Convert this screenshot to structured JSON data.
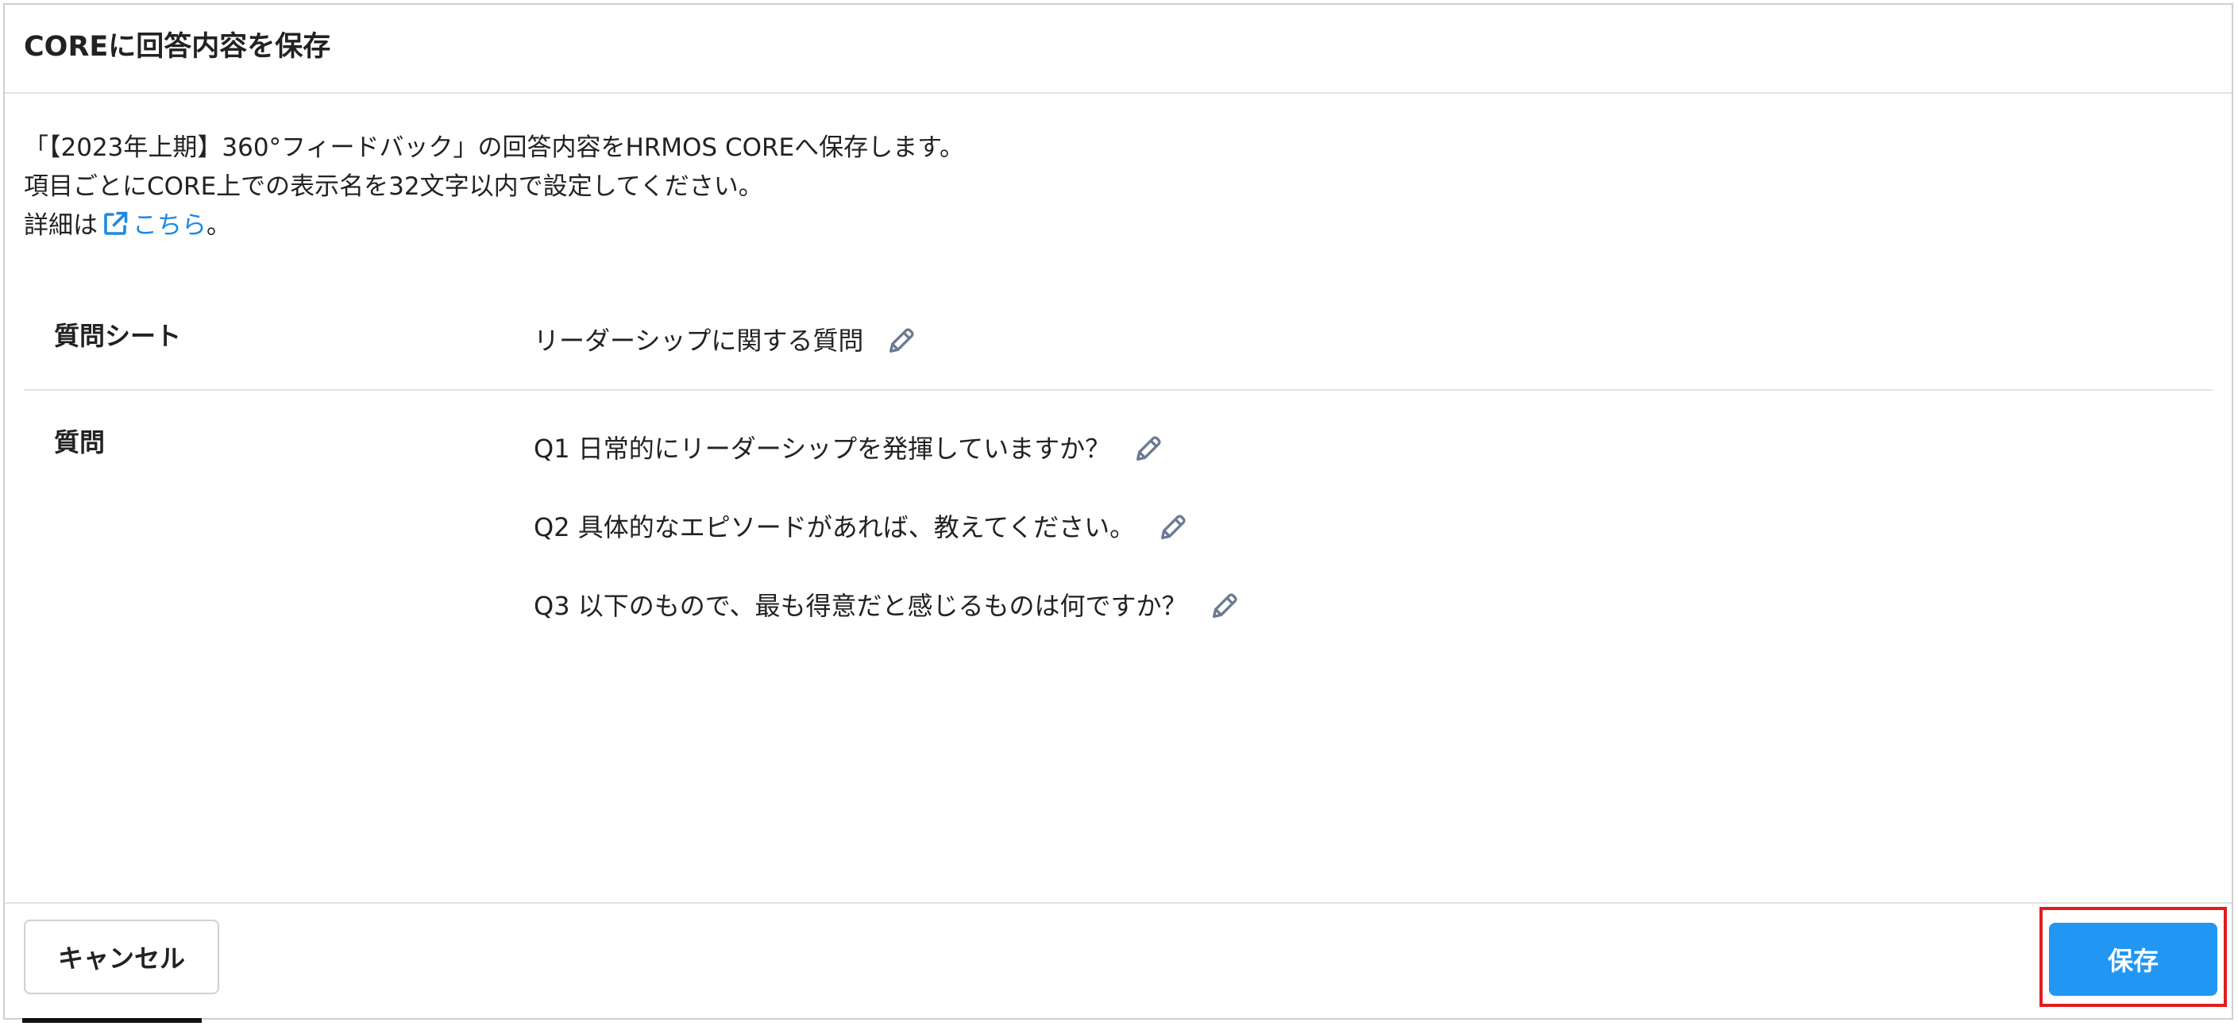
{
  "dialog": {
    "title": "COREに回答内容を保存"
  },
  "intro": {
    "line1": "「【2023年上期】360°フィードバック」の回答内容をHRMOS COREへ保存します。",
    "line2": "項目ごとにCORE上での表示名を32文字以内で設定してください。",
    "line3_prefix": "詳細は",
    "link_label": "こちら",
    "line3_suffix": "。"
  },
  "question_sheet": {
    "label": "質問シート",
    "value": "リーダーシップに関する質問"
  },
  "questions": {
    "label": "質問",
    "items": [
      {
        "text": "Q1 日常的にリーダーシップを発揮していますか？"
      },
      {
        "text": "Q2 具体的なエピソードがあれば、教えてください。"
      },
      {
        "text": "Q3 以下のもので、最も得意だと感じるものは何ですか？"
      }
    ]
  },
  "footer": {
    "cancel_label": "キャンセル",
    "save_label": "保存"
  },
  "colors": {
    "accent": "#2196f3",
    "link": "#1e88e5",
    "highlight": "#e01e1e",
    "icon": "#6b7a90"
  },
  "icons": {
    "external_link": "external-link-icon",
    "edit": "pencil-icon"
  }
}
